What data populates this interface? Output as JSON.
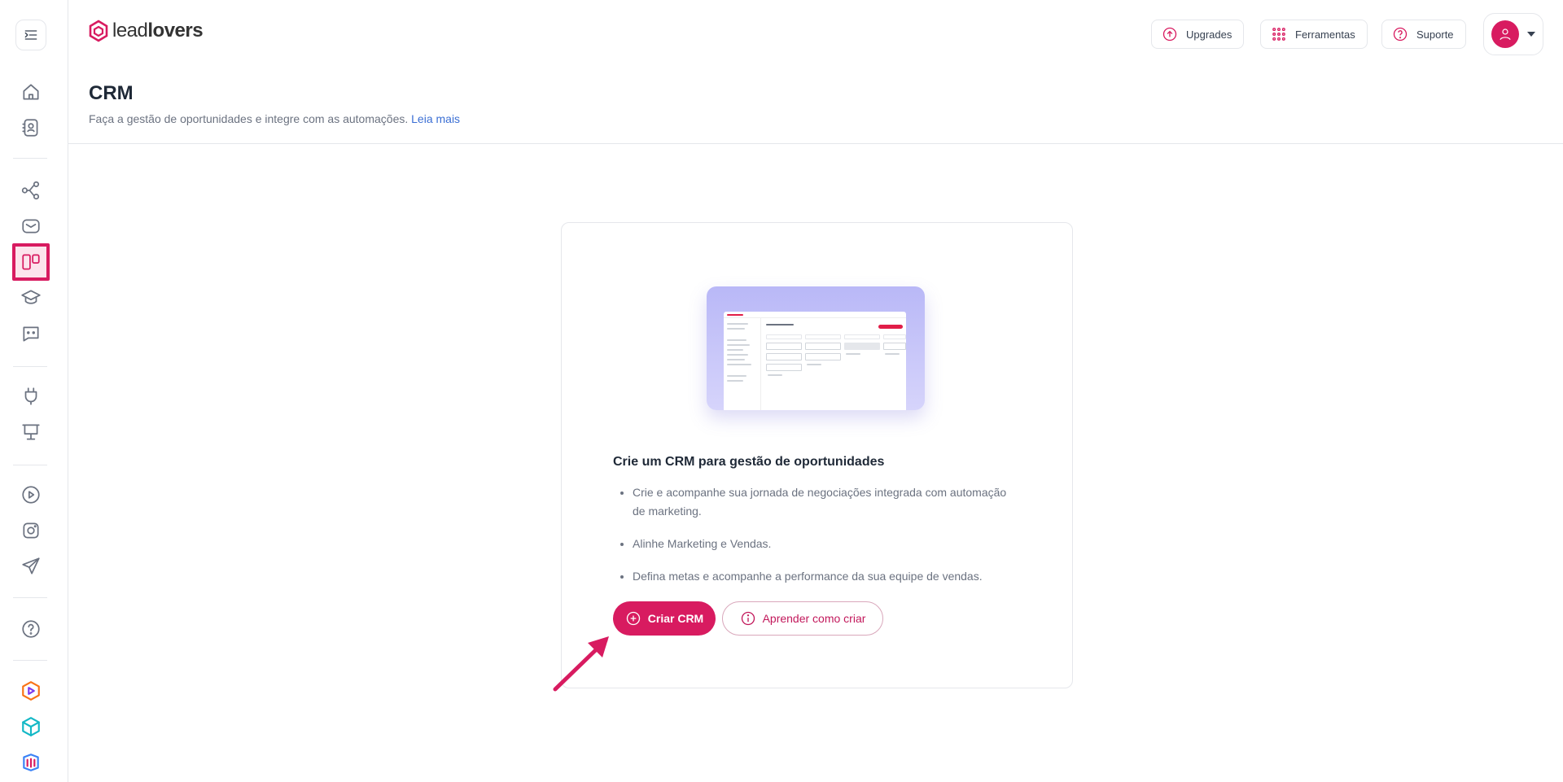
{
  "brand": {
    "logo_light": "lead",
    "logo_bold": "lovers",
    "accent": "#d81b60"
  },
  "sidebar": {
    "items": [
      {
        "icon": "menu-toggle-icon"
      },
      {
        "icon": "home-icon"
      },
      {
        "icon": "contacts-icon"
      },
      {
        "icon": "automation-flow-icon"
      },
      {
        "icon": "mail-icon"
      },
      {
        "icon": "crm-board-icon",
        "active": true
      },
      {
        "icon": "graduation-cap-icon"
      },
      {
        "icon": "chat-bot-icon"
      },
      {
        "icon": "plug-icon"
      },
      {
        "icon": "presentation-icon"
      },
      {
        "icon": "play-icon"
      },
      {
        "icon": "instagram-icon"
      },
      {
        "icon": "send-icon"
      },
      {
        "icon": "help-icon"
      },
      {
        "icon": "product-play-logo-icon"
      },
      {
        "icon": "product-box-logo-icon"
      },
      {
        "icon": "product-stack-logo-icon"
      }
    ]
  },
  "topbar": {
    "upgrades_label": "Upgrades",
    "ferramentas_label": "Ferramentas",
    "suporte_label": "Suporte"
  },
  "page": {
    "title": "CRM",
    "subtitle": "Faça a gestão de oportunidades e integre com as automações.",
    "read_more": "Leia mais"
  },
  "card": {
    "title": "Crie um CRM para gestão de oportunidades",
    "bullets": [
      "Crie e acompanhe sua jornada de negociações integrada com automação de marketing.",
      "Alinhe Marketing e Vendas.",
      "Defina metas e acompanhe a performance da sua equipe de vendas."
    ],
    "primary_button": "Criar CRM",
    "secondary_button": "Aprender como criar"
  }
}
